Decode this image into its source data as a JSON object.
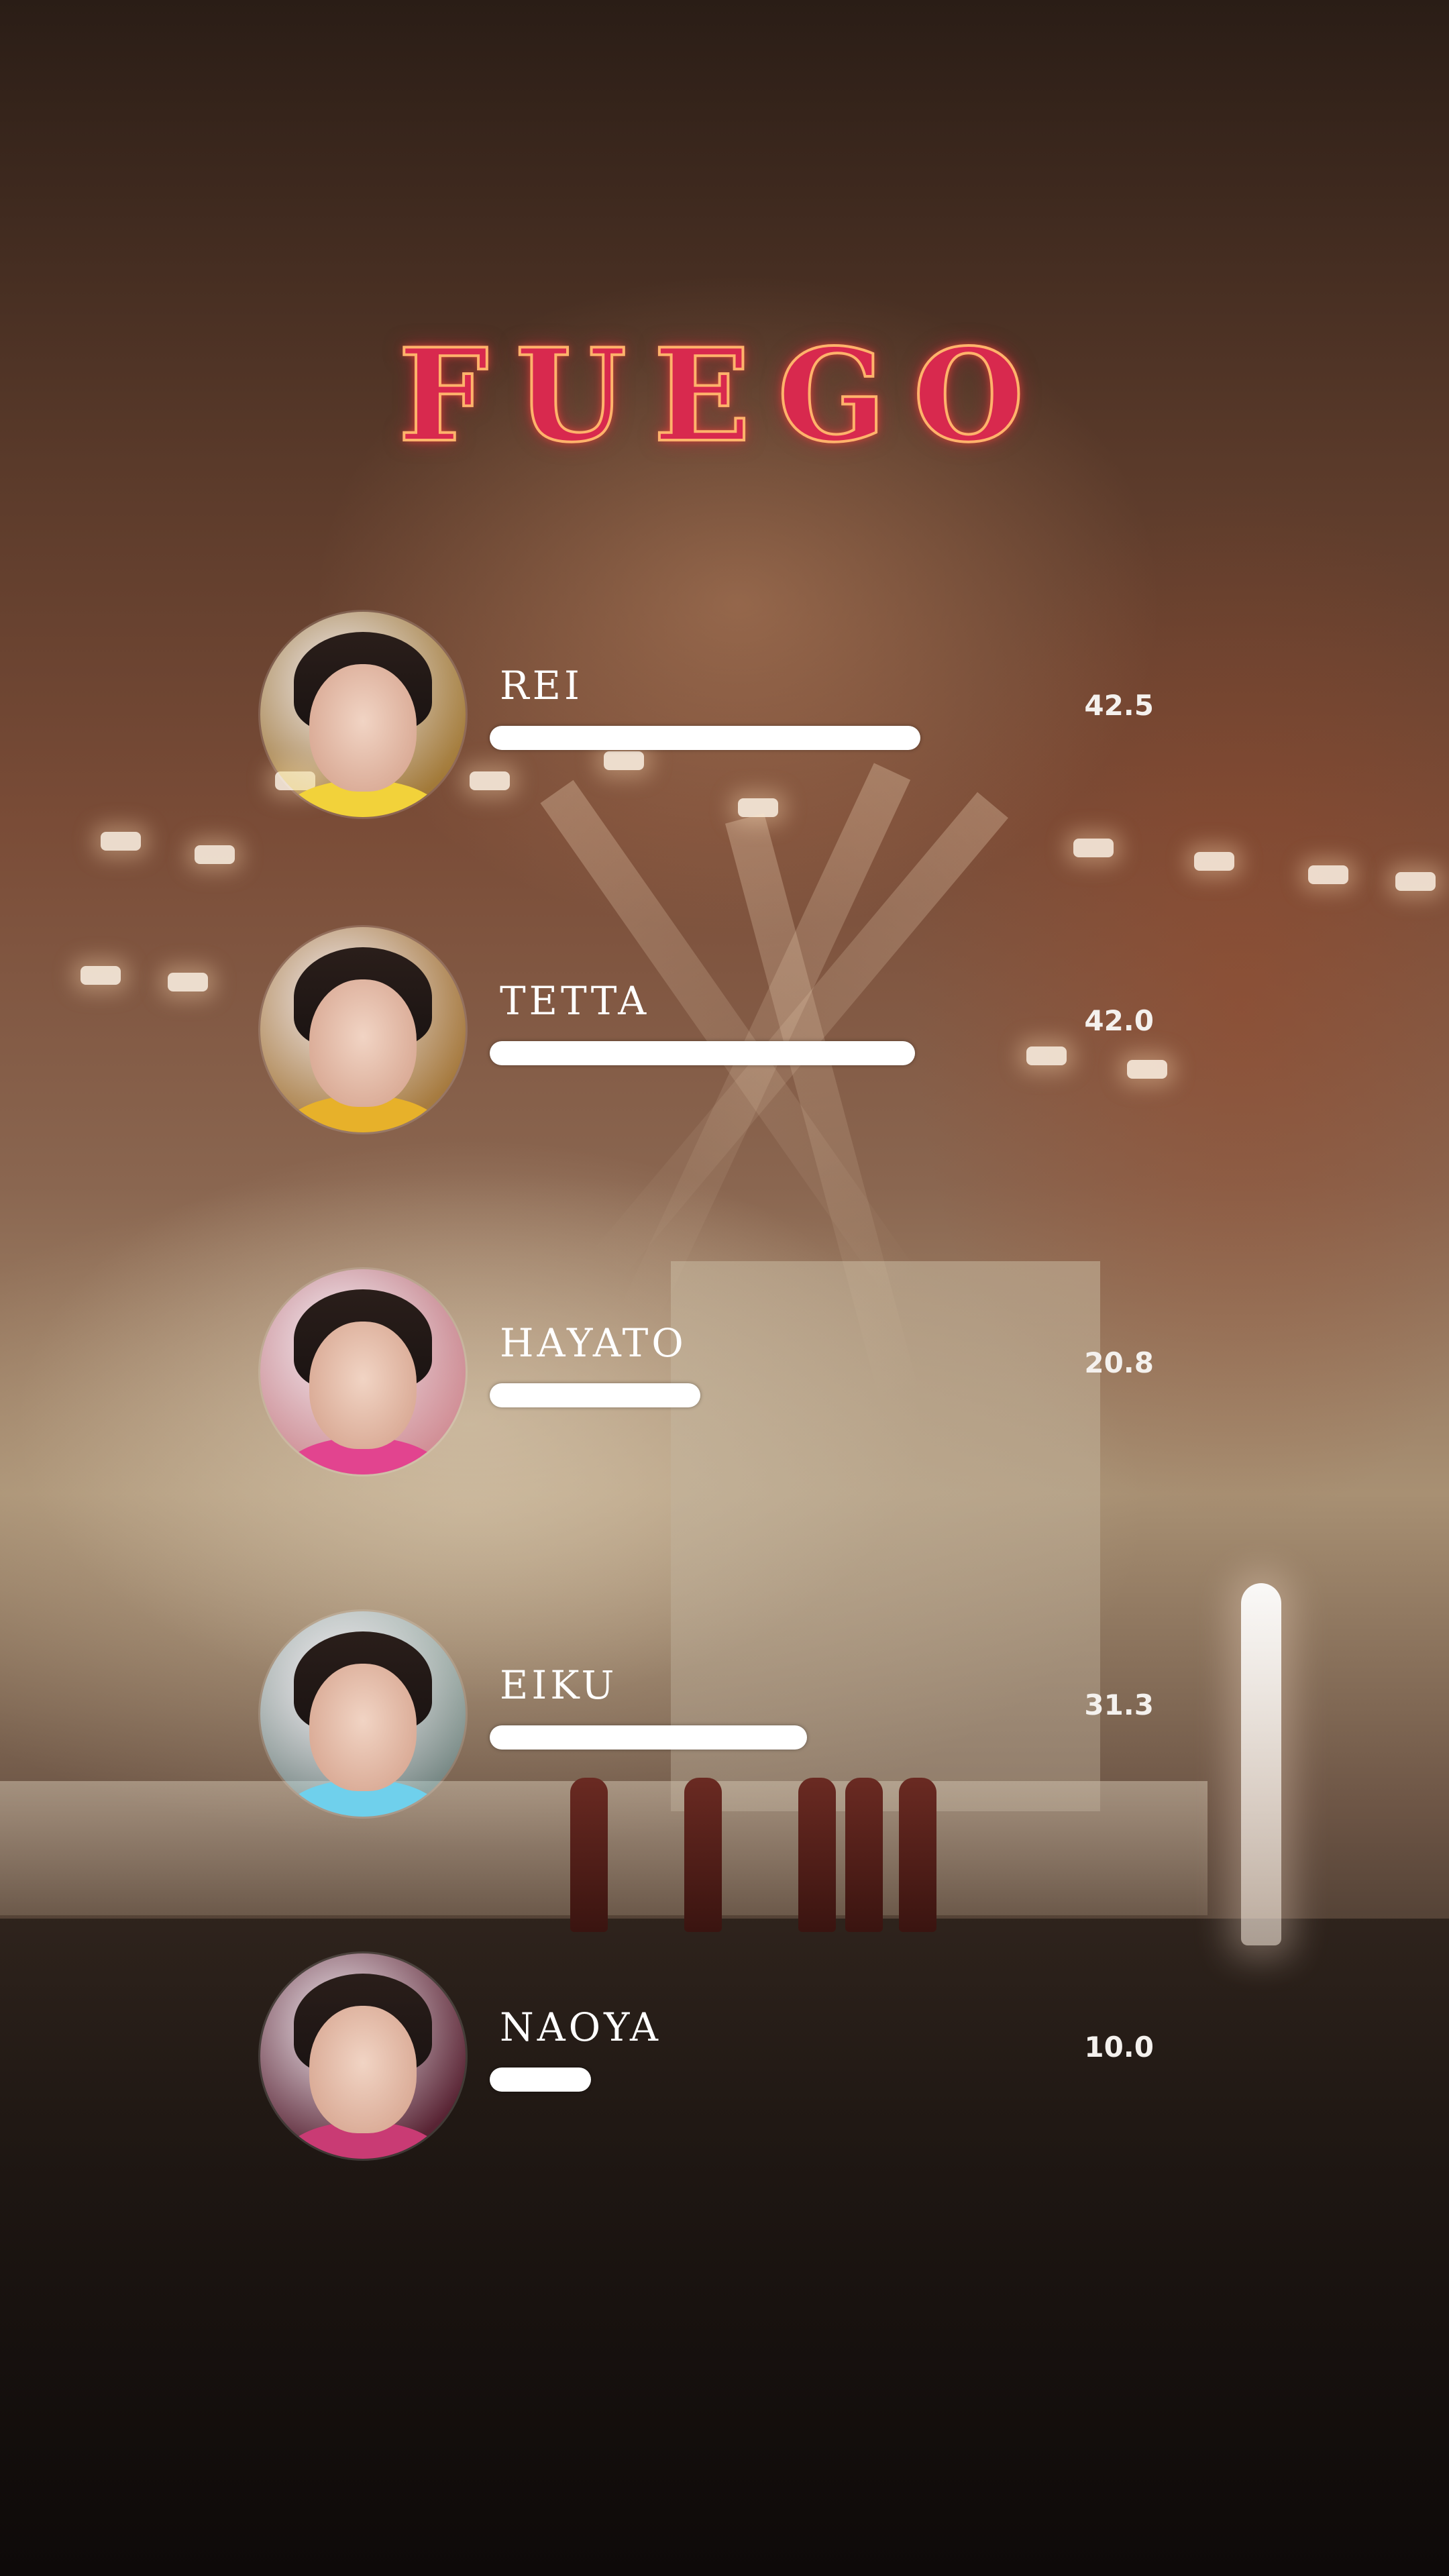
{
  "title": "FUEGO",
  "chart_data": {
    "type": "bar",
    "orientation": "horizontal",
    "title": "FUEGO",
    "categories": [
      "REI",
      "TETTA",
      "HAYATO",
      "EIKU",
      "NAOYA"
    ],
    "values": [
      42.5,
      42.0,
      20.8,
      31.3,
      10.0
    ],
    "value_labels": [
      "42.5",
      "42.0",
      "20.8",
      "31.3",
      "10.0"
    ],
    "xlim": [
      0,
      65
    ],
    "grid": false,
    "legend": "none",
    "bar_color": "#ffffff",
    "title_color": "#d8294e",
    "avatars": [
      {
        "icon": "avatar-rei",
        "accent": "#f2d23a"
      },
      {
        "icon": "avatar-tetta",
        "accent": "#e7b12a"
      },
      {
        "icon": "avatar-hayato",
        "accent": "#e2448f"
      },
      {
        "icon": "avatar-eiku",
        "accent": "#6fd0ec"
      },
      {
        "icon": "avatar-naoya",
        "accent": "#c93b74"
      }
    ]
  }
}
